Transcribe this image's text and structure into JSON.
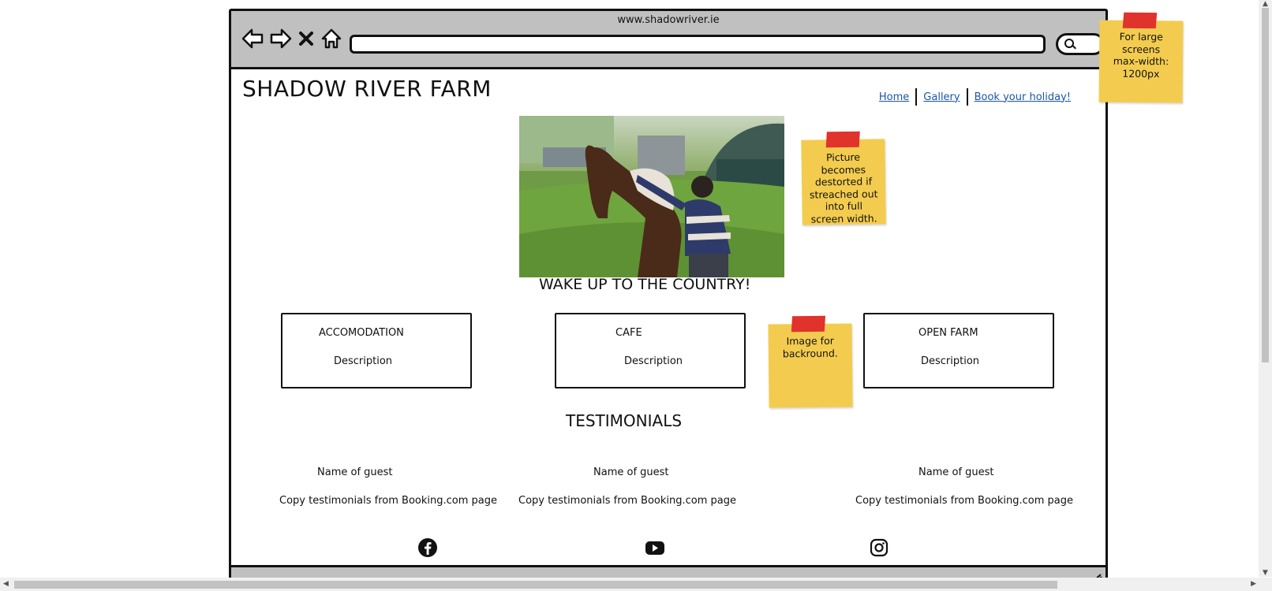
{
  "browser": {
    "url": "www.shadowriver.ie",
    "nav_icons": [
      "back-arrow-icon",
      "forward-arrow-icon",
      "close-x-icon",
      "home-icon"
    ],
    "search_icon": "search-icon"
  },
  "site": {
    "title": "SHADOW RIVER FARM",
    "nav": [
      "Home",
      "Gallery",
      "Book your holiday!"
    ],
    "hero_tagline": "WAKE UP TO THE COUNTRY!"
  },
  "cards": [
    {
      "title": "ACCOMODATION",
      "description": "Description"
    },
    {
      "title": "CAFE",
      "description": "Description"
    },
    {
      "title": "OPEN FARM",
      "description": "Description"
    }
  ],
  "testimonials": {
    "heading": "TESTIMONIALS",
    "items": [
      {
        "name": "Name of guest",
        "text": "Copy testimonials from Booking.com page"
      },
      {
        "name": "Name of guest",
        "text": "Copy testimonials from Booking.com page"
      },
      {
        "name": "Name of guest",
        "text": "Copy testimonials from Booking.com page"
      }
    ]
  },
  "social": [
    "facebook-icon",
    "youtube-icon",
    "instagram-icon"
  ],
  "notes": {
    "large_screens": "For large screens max-width: 1200px",
    "picture": "Picture becomes destorted if streached out into full screen width.",
    "background": "Image for backround."
  },
  "colors": {
    "note": "#f3cc4f",
    "tape": "#e0332b",
    "chrome": "#c0c0c0",
    "link": "#1a56a8"
  }
}
